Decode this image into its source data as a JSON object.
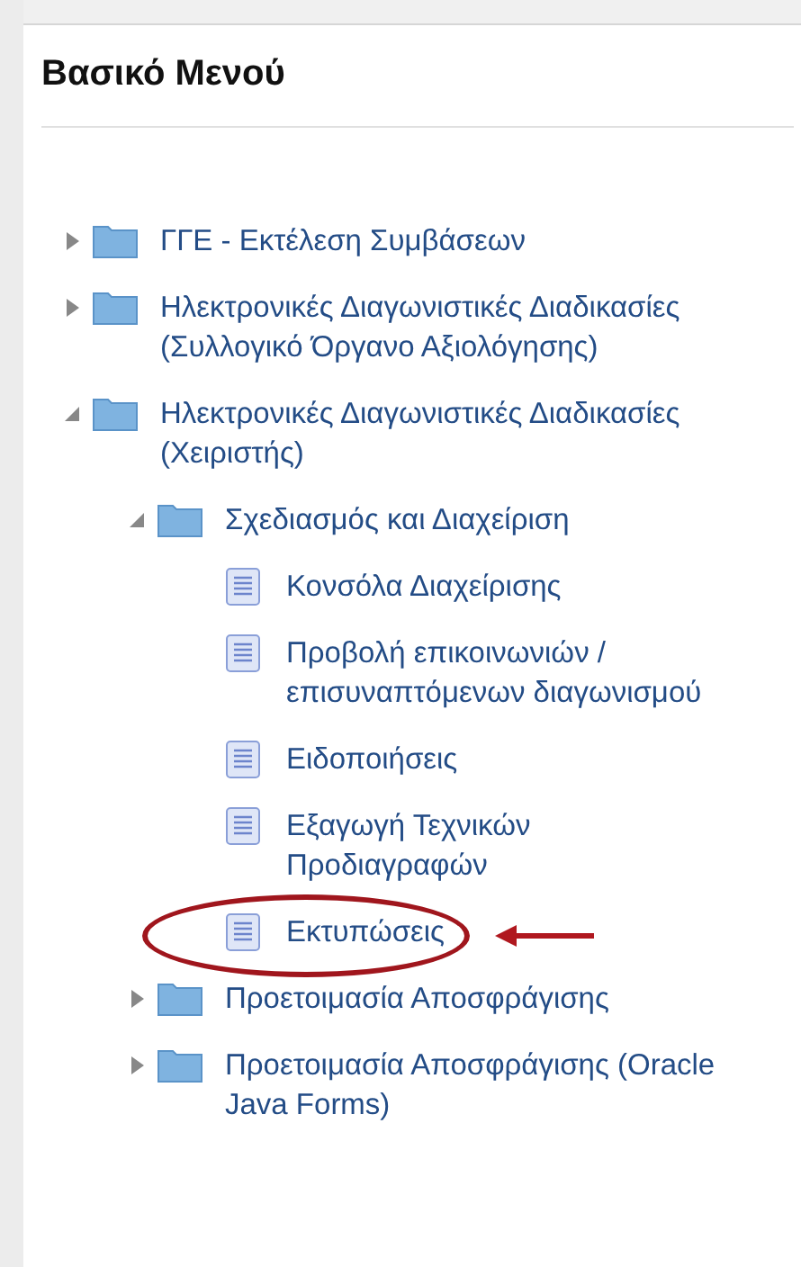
{
  "panel": {
    "title": "Βασικό Μενού"
  },
  "tree": [
    {
      "kind": "folder",
      "label": "ΓΓΕ - Εκτέλεση Συμβάσεων",
      "expanded": false
    },
    {
      "kind": "folder",
      "label": "Ηλεκτρονικές Διαγωνιστικές Διαδικασίες (Συλλογικό Όργανο Αξιολόγησης)",
      "expanded": false
    },
    {
      "kind": "folder",
      "label": "Ηλεκτρονικές Διαγωνιστικές Διαδικασίες (Χειριστής)",
      "expanded": true,
      "children": [
        {
          "kind": "folder",
          "label": "Σχεδιασμός και Διαχείριση",
          "expanded": true,
          "children": [
            {
              "kind": "page",
              "label": "Κονσόλα Διαχείρισης",
              "annotated": false
            },
            {
              "kind": "page",
              "label": "Προβολή επικοινωνιών / επισυναπτόμενων διαγωνισμού",
              "annotated": false
            },
            {
              "kind": "page",
              "label": "Ειδοποιήσεις",
              "annotated": false
            },
            {
              "kind": "page",
              "label": "Εξαγωγή Τεχνικών Προδιαγραφών",
              "annotated": false
            },
            {
              "kind": "page",
              "label": "Εκτυπώσεις",
              "annotated": true
            }
          ]
        },
        {
          "kind": "folder",
          "label": "Προετοιμασία Αποσφράγισης",
          "expanded": false
        },
        {
          "kind": "folder",
          "label": "Προετοιμασία Αποσφράγισης (Oracle Java Forms)",
          "expanded": false
        }
      ]
    }
  ]
}
